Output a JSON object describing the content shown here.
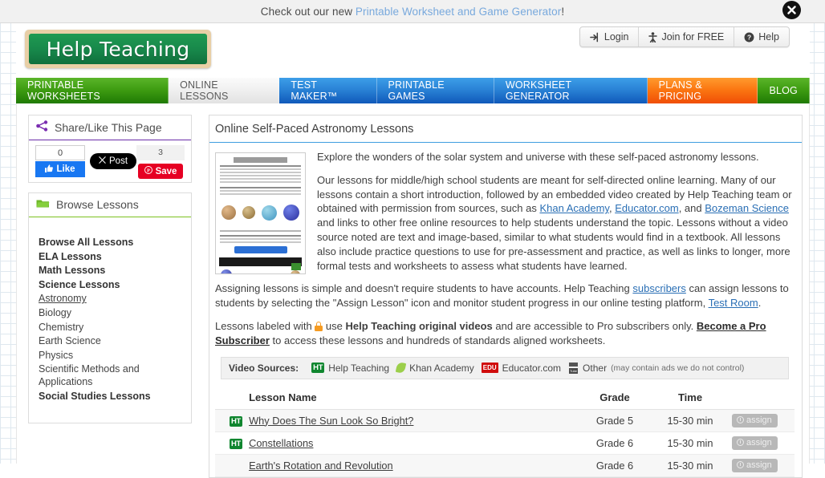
{
  "topbar": {
    "prefix": "Check out our new ",
    "link": "Printable Worksheet and Game Generator",
    "suffix": "!",
    "close_label": "✖"
  },
  "header": {
    "logo_text": "Help Teaching",
    "auth": [
      {
        "label": "Login",
        "icon": "login-icon"
      },
      {
        "label": "Join for FREE",
        "icon": "person-icon"
      },
      {
        "label": "Help",
        "icon": "question-circle-icon"
      }
    ]
  },
  "nav": [
    {
      "label": "PRINTABLE WORKSHEETS",
      "style": "green",
      "active": false
    },
    {
      "label": "ONLINE LESSONS",
      "style": "active",
      "active": true
    },
    {
      "label": "TEST MAKER™",
      "style": "blue",
      "active": false
    },
    {
      "label": "PRINTABLE GAMES",
      "style": "blue",
      "active": false
    },
    {
      "label": "WORKSHEET GENERATOR",
      "style": "blue",
      "active": false
    },
    {
      "label": "PLANS & PRICING",
      "style": "orange",
      "active": false
    },
    {
      "label": "BLOG",
      "style": "darkgreen",
      "active": false
    }
  ],
  "sidebar": {
    "share": {
      "title": "Share/Like This Page",
      "fb_count": "0",
      "fb_like": "Like",
      "x_post": "Post",
      "pin_count": "3",
      "pin_save": "Save"
    },
    "browse": {
      "title": "Browse Lessons",
      "items": [
        {
          "label": "Browse All Lessons",
          "bold": true,
          "current": false
        },
        {
          "label": "ELA Lessons",
          "bold": true,
          "current": false
        },
        {
          "label": "Math Lessons",
          "bold": true,
          "current": false
        },
        {
          "label": "Science Lessons",
          "bold": true,
          "current": false
        },
        {
          "label": "Astronomy",
          "bold": false,
          "current": true
        },
        {
          "label": "Biology",
          "bold": false,
          "current": false
        },
        {
          "label": "Chemistry",
          "bold": false,
          "current": false
        },
        {
          "label": "Earth Science",
          "bold": false,
          "current": false
        },
        {
          "label": "Physics",
          "bold": false,
          "current": false
        },
        {
          "label": "Scientific Methods and Applications",
          "bold": false,
          "current": false
        },
        {
          "label": "Social Studies Lessons",
          "bold": true,
          "current": false
        }
      ]
    }
  },
  "main": {
    "title": "Online Self-Paced Astronomy Lessons",
    "p1": "Explore the wonders of the solar system and universe with these self-paced astronomy lessons.",
    "p2": {
      "a": "Our lessons for middle/high school students are meant for self-directed online learning. Many of our lessons contain a short introduction, followed by an embedded video created by Help Teaching team or obtained with permission from sources, such as ",
      "link1": "Khan Academy",
      "sep1": ", ",
      "link2": "Educator.com",
      "sep2": ", and ",
      "link3": "Bozeman Science",
      "b": " and links to other free online resources to help students understand the topic. Lessons without a video source noted are text and image-based, similar to what students would find in a textbook. All lessons also include practice questions to use for pre-assessment and practice, as well as links to longer, more formal tests and worksheets to assess what students have learned."
    },
    "p3": {
      "a": "Assigning lessons is simple and doesn't require students to have accounts. Help Teaching ",
      "link1": "subscribers",
      "b": " can assign lessons to students by selecting the \"Assign Lesson\" icon and monitor student progress in our online testing platform, ",
      "link2": "Test Room",
      "c": "."
    },
    "p4": {
      "a": "Lessons labeled with ",
      "b": " use ",
      "strong1": "Help Teaching original videos",
      "c": " and are accessible to Pro subscribers only. ",
      "link1": "Become a Pro Subscriber",
      "d": " to access these lessons and hundreds of standards aligned worksheets."
    },
    "video_sources": {
      "label": "Video Sources:",
      "items": [
        {
          "badge": "HT",
          "label": "Help Teaching",
          "note": ""
        },
        {
          "badge": "leaf",
          "label": "Khan Academy",
          "note": ""
        },
        {
          "badge": "EDU",
          "label": "Educator.com",
          "note": ""
        },
        {
          "badge": "yt",
          "label": "Other",
          "note": "(may contain ads we do not control)"
        }
      ]
    },
    "table": {
      "headers": [
        "Lesson Name",
        "Grade",
        "Time",
        ""
      ],
      "assign_label": "assign",
      "rows": [
        {
          "ht": true,
          "name": "Why Does The Sun Look So Bright?",
          "grade": "Grade 5",
          "time": "15-30 min"
        },
        {
          "ht": true,
          "name": "Constellations",
          "grade": "Grade 6",
          "time": "15-30 min"
        },
        {
          "ht": false,
          "name": "Earth's Rotation and Revolution",
          "grade": "Grade 6",
          "time": "15-30 min"
        }
      ]
    }
  }
}
